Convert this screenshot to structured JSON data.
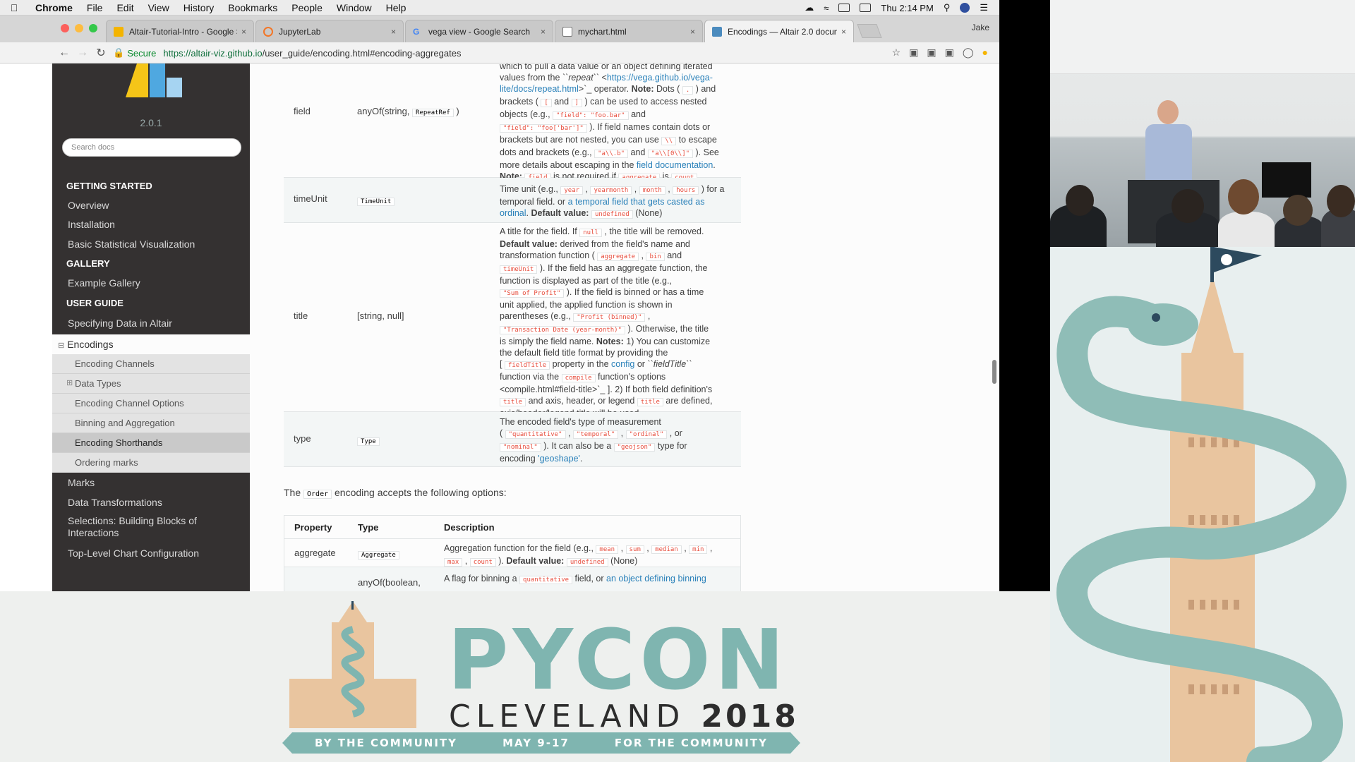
{
  "menubar": {
    "app": "Chrome",
    "items": [
      "File",
      "Edit",
      "View",
      "History",
      "Bookmarks",
      "People",
      "Window",
      "Help"
    ],
    "clock": "Thu 2:14 PM"
  },
  "tabs": [
    {
      "title": "Altair-Tutorial-Intro - Google S"
    },
    {
      "title": "JupyterLab"
    },
    {
      "title": "vega view - Google Search"
    },
    {
      "title": "mychart.html"
    },
    {
      "title": "Encodings — Altair 2.0 docum"
    }
  ],
  "profile_name": "Jake",
  "address": {
    "secure_label": "Secure",
    "host": "https://altair-viz.github.io",
    "path": "/user_guide/encoding.html#encoding-aggregates"
  },
  "sidebar": {
    "version": "2.0.1",
    "search_placeholder": "Search docs",
    "cap_getting_started": "GETTING STARTED",
    "overview": "Overview",
    "installation": "Installation",
    "basic_stat": "Basic Statistical Visualization",
    "cap_gallery": "GALLERY",
    "example_gallery": "Example Gallery",
    "cap_user_guide": "USER GUIDE",
    "specifying_data": "Specifying Data in Altair",
    "encodings": "Encodings",
    "sub": [
      "Encoding Channels",
      "Data Types",
      "Encoding Channel Options",
      "Binning and Aggregation",
      "Encoding Shorthands",
      "Ordering marks"
    ],
    "marks": "Marks",
    "data_transformations": "Data Transformations",
    "selections": "Selections: Building Blocks of Interactions",
    "top_level": "Top-Level Chart Configuration"
  },
  "content": {
    "field": {
      "prop": "field",
      "type_text": "anyOf(string, ",
      "type_code": "RepeatRef",
      "type_close": " )",
      "l1": "which to pull a data value or an object defining iterated",
      "l2a": "values from the ",
      "l2b": "``repeat``",
      "l2c": " <",
      "l2d": "https://vega.github.io/vega-",
      "l3a": "lite/docs/repeat.html",
      "l3b": ">`_ operator. ",
      "l3c": "Note:",
      "l3d": " Dots ( ",
      "l3e": ".",
      "l3f": " ) and",
      "l4a": "brackets ( ",
      "l4b": "[",
      "l4c": " and ",
      "l4d": "]",
      "l4e": " ) can be used to access nested",
      "l5a": "objects (e.g., ",
      "l5b": "\"field\": \"foo.bar\"",
      "l5c": " and",
      "l6a": "\"field\": \"foo['bar']\"",
      "l6b": " ). If field names contain dots or",
      "l7a": "brackets but are not nested, you can use ",
      "l7b": "\\\\",
      "l7c": " to escape",
      "l8a": "dots and brackets (e.g., ",
      "l8b": "\"a\\\\.b\"",
      "l8c": " and ",
      "l8d": "\"a\\\\[0\\\\]\"",
      "l8e": " ). See",
      "l9a": "more details about escaping in the ",
      "l9b": "field documentation",
      "l9c": ".",
      "l10a": "Note:",
      "l10b": " ",
      "l10c": "field",
      "l10d": " is not required if ",
      "l10e": "aggregate",
      "l10f": " is ",
      "l10g": "count",
      "l10h": " ."
    },
    "timeunit": {
      "prop": "timeUnit",
      "type_code": "TimeUnit",
      "l1a": "Time unit (e.g., ",
      "c1": "year",
      "c2": "yearmonth",
      "c3": "month",
      "c4": "hours",
      "l1b": " ) for a",
      "l2a": "temporal field. or ",
      "l2b": "a temporal field that gets casted as",
      "l3a": "ordinal",
      "l3b": ". ",
      "l3c": "Default value:",
      "l3d": "undefined",
      "l3e": " (None)"
    },
    "title": {
      "prop": "title",
      "type_text": "[string, null]",
      "l1a": "A title for the field. If ",
      "l1b": "null",
      "l1c": " , the title will be removed.",
      "l2a": "Default value:",
      "l2b": " derived from the field's name and",
      "l3a": "transformation function ( ",
      "l3b": "aggregate",
      "l3c": " , ",
      "l3d": "bin",
      "l3e": " and",
      "l4a": "timeUnit",
      "l4b": " ). If the field has an aggregate function, the",
      "l5": "function is displayed as part of the title (e.g.,",
      "l6a": "\"Sum of Profit\"",
      "l6b": " ). If the field is binned or has a time",
      "l7": "unit applied, the applied function is shown in",
      "l8a": "parentheses (e.g., ",
      "l8b": "\"Profit (binned)\"",
      "l8c": " ,",
      "l9a": "\"Transaction Date (year-month)\"",
      "l9b": " ). Otherwise, the title",
      "l10a": "is simply the field name. ",
      "l10b": "Notes:",
      "l10c": " 1) You can customize",
      "l11": "the default field title format by providing the",
      "l12a": "[ ",
      "l12b": "fieldTitle",
      "l12c": " property in the ",
      "l12d": "config",
      "l12e": " or ",
      "l12f": "``fieldTitle``",
      "l13a": "function via the ",
      "l13b": "compile",
      "l13c": " function's options",
      "l14": "<compile.html#field-title>`_ ]. 2) If both field definition's",
      "l15a": "title",
      "l15b": " and axis, header, or legend ",
      "l15c": "title",
      "l15d": " are defined,",
      "l16": "axis/header/legend title will be used."
    },
    "type": {
      "prop": "type",
      "type_code": "Type",
      "l1": "The encoded field's type of measurement",
      "l2a": "( ",
      "c1": "\"quantitative\"",
      "c2": "\"temporal\"",
      "c3": "\"ordinal\"",
      "l2b": " , or",
      "l3a": "\"nominal\"",
      "l3b": " ). It can also be a ",
      "l3c": "\"geojson\"",
      "l3d": " type for",
      "l4a": "encoding ",
      "l4b": "'geoshape'",
      "l4c": "."
    },
    "order_para": {
      "pre": "The ",
      "code": "Order",
      "post": " encoding accepts the following options:"
    },
    "table2": {
      "h1": "Property",
      "h2": "Type",
      "h3": "Description",
      "agg_prop": "aggregate",
      "agg_type": "Aggregate",
      "agg_l1a": "Aggregation function for the field (e.g., ",
      "ac1": "mean",
      "ac2": "sum",
      "ac3": "median",
      "ac4": "min",
      "agg_l2a": "max",
      "agg_l2b": "count",
      "agg_l2c": ". ",
      "agg_l2d": "Default value:",
      "agg_l2e": "undefined",
      "agg_l2f": " (None)",
      "bin_type": "anyOf(boolean,",
      "bin_l1a": "A flag for binning a ",
      "bin_l1b": "quantitative",
      "bin_l1c": " field, or ",
      "bin_l1d": "an object defining binning"
    }
  },
  "banner": {
    "pycon": "PYCON",
    "city": "CLEVELAND",
    "year": "2018",
    "r1": "BY THE COMMUNITY",
    "r2": "MAY 9-17",
    "r3": "FOR THE COMMUNITY"
  },
  "colors": {
    "sidebar_bg": "#343131",
    "link": "#2980b9",
    "code_red": "#e74c3c",
    "pycon_teal": "#7fb5b0"
  }
}
